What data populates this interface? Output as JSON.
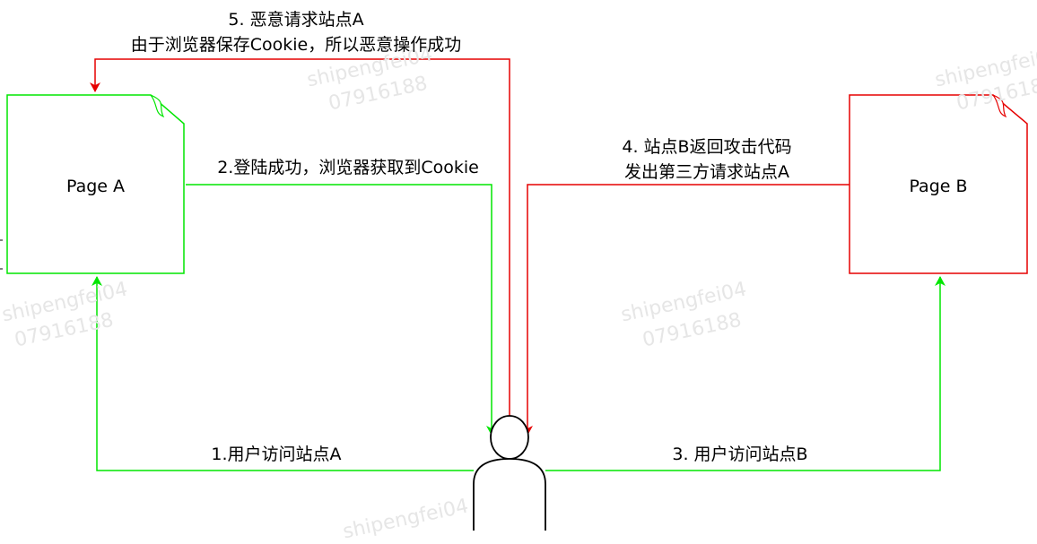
{
  "colors": {
    "green": "#00e600",
    "red": "#e60000",
    "stroke": "#000000",
    "watermark": "#e6e6e6",
    "background": "#ffffff"
  },
  "nodes": {
    "page_a": {
      "label": "Page A"
    },
    "page_b": {
      "label": "Page B"
    },
    "user": {
      "icon": "user-icon"
    }
  },
  "edges": {
    "step1": {
      "label": "1.用户访问站点A"
    },
    "step2": {
      "label": "2.登陆成功，浏览器获取到Cookie"
    },
    "step3": {
      "label": "3. 用户访问站点B"
    },
    "step4": {
      "line1": "4. 站点B返回攻击代码",
      "line2": "发出第三方请求站点A"
    },
    "step5": {
      "line1": "5. 恶意请求站点A",
      "line2": "由于浏览器保存Cookie，所以恶意操作成功"
    }
  },
  "watermark": {
    "name": "shipengfei04",
    "number": "07916188"
  }
}
